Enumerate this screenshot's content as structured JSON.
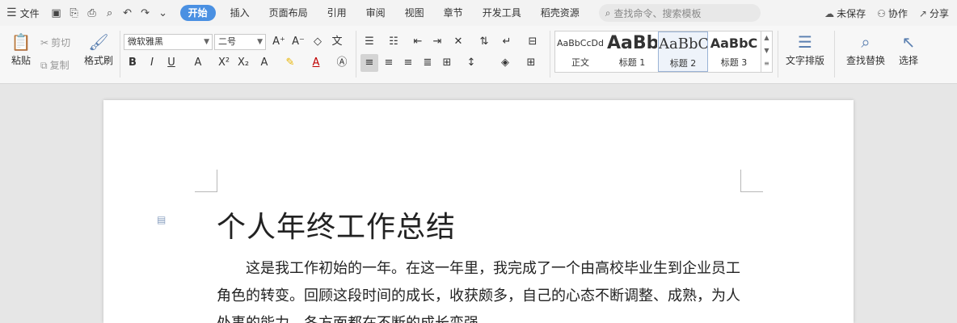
{
  "menubar": {
    "menu_label": "文件",
    "tabs": [
      "开始",
      "插入",
      "页面布局",
      "引用",
      "审阅",
      "视图",
      "章节",
      "开发工具",
      "稻壳资源"
    ],
    "search_placeholder": "查找命令、搜索模板",
    "unsaved_label": "未保存",
    "collab_label": "协作",
    "share_label": "分享"
  },
  "ribbon": {
    "paste_label": "粘贴",
    "cut_label": "剪切",
    "copy_label": "复制",
    "format_painter_label": "格式刷",
    "font_family": "微软雅黑",
    "font_size": "二号",
    "styles": [
      {
        "preview": "AaBbCcDd",
        "label": "正文"
      },
      {
        "preview": "AaBb",
        "label": "标题 1"
      },
      {
        "preview": "AaBbC",
        "label": "标题 2"
      },
      {
        "preview": "AaBbC",
        "label": "标题 3"
      }
    ],
    "text_layout_label": "文字排版",
    "find_replace_label": "查找替换",
    "select_label": "选择"
  },
  "document": {
    "title": "个人年终工作总结",
    "paragraph": "这是我工作初始的一年。在这一年里，我完成了一个由高校毕业生到企业员工角色的转变。回顾这段时间的成长，收获颇多，自己的心态不断调整、成熟，为人处事的能力、各方面都在不断的成长变强。"
  },
  "colors": {
    "accent": "#4a90e2",
    "ribbon_bg": "#f7f7f7",
    "workspace_bg": "#e6e6e6"
  }
}
